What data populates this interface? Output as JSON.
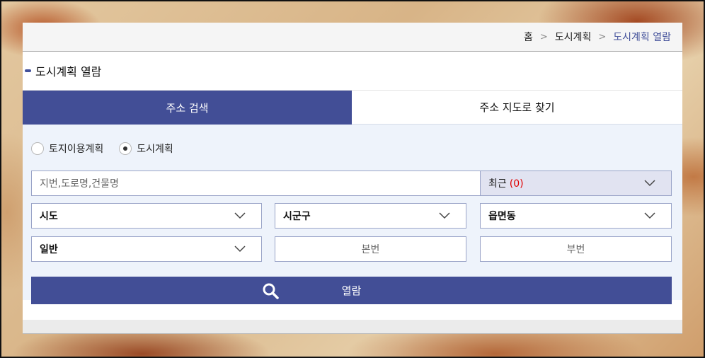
{
  "breadcrumb": {
    "home": "홈",
    "level1": "도시계획",
    "current": "도시계획 열람",
    "separator": ">"
  },
  "page": {
    "title": "도시계획 열람"
  },
  "tabs": [
    {
      "label": "주소 검색",
      "active": true
    },
    {
      "label": "주소 지도로 찾기",
      "active": false
    }
  ],
  "radios": [
    {
      "label": "토지이용계획",
      "checked": false
    },
    {
      "label": "도시계획",
      "checked": true
    }
  ],
  "search": {
    "placeholder": "지번,도로명,건물명",
    "recent_label": "최근",
    "recent_count": "(0)"
  },
  "selects": {
    "sido": "시도",
    "sigungu": "시군구",
    "eupmyeondong": "읍면동",
    "type": "일반"
  },
  "inputs": {
    "bonbun_placeholder": "본번",
    "bubun_placeholder": "부번"
  },
  "button": {
    "label": "열람",
    "icon": "search-icon"
  },
  "colors": {
    "accent": "#424e96",
    "recent_count": "#e00000",
    "search_area_bg": "#eef3fb"
  }
}
